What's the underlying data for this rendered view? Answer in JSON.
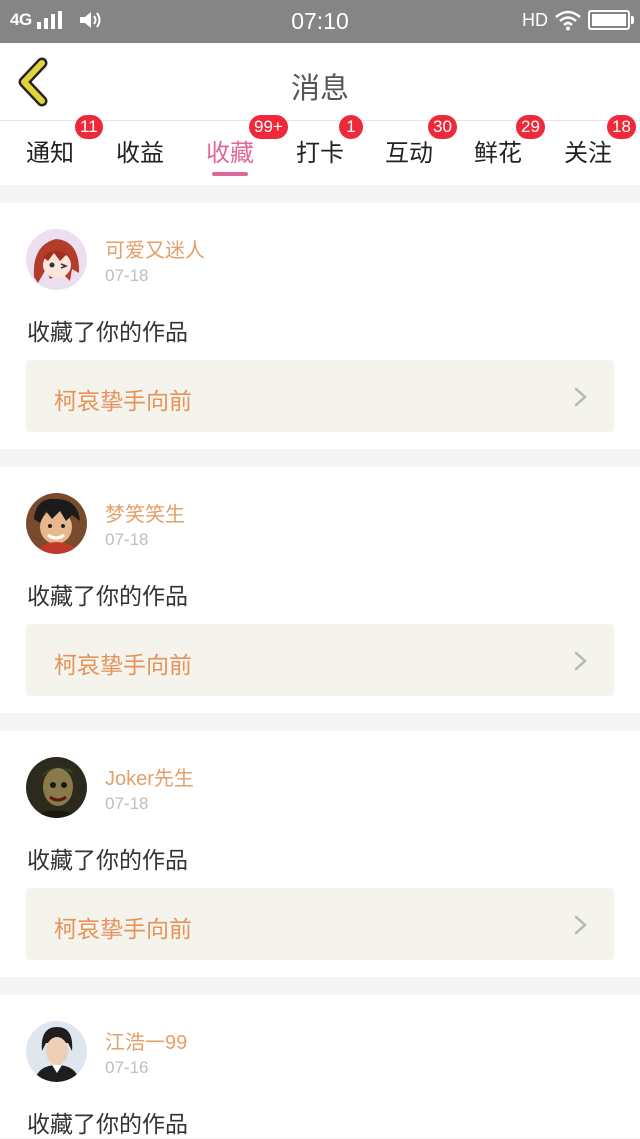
{
  "status_bar": {
    "network": "4G",
    "time": "07:10",
    "hd": "HD",
    "icons": [
      "signal-icon",
      "volume-icon",
      "wifi-icon",
      "battery-icon"
    ]
  },
  "header": {
    "title": "消息",
    "back_icon": "back-chevron-icon",
    "accent_color": "#e3d23a"
  },
  "tabs": [
    {
      "label": "通知",
      "badge": "11"
    },
    {
      "label": "收益",
      "badge": ""
    },
    {
      "label": "收藏",
      "badge": "99+",
      "active": true
    },
    {
      "label": "打卡",
      "badge": "1"
    },
    {
      "label": "互动",
      "badge": "30"
    },
    {
      "label": "鲜花",
      "badge": "29"
    },
    {
      "label": "关注",
      "badge": "18"
    }
  ],
  "feed": [
    {
      "user": "可爱又迷人",
      "date": "07-18",
      "action": "收藏了你的作品",
      "work": "柯哀挚手向前"
    },
    {
      "user": "梦笑笑生",
      "date": "07-18",
      "action": "收藏了你的作品",
      "work": "柯哀挚手向前"
    },
    {
      "user": "Joker先生",
      "date": "07-18",
      "action": "收藏了你的作品",
      "work": "柯哀挚手向前"
    },
    {
      "user": "江浩一99",
      "date": "07-16",
      "action": "收藏了你的作品",
      "work": ""
    }
  ],
  "colors": {
    "active_tab": "#e0679a",
    "badge": "#ee2a3a",
    "username": "#e2a06b",
    "work_title": "#e6935b",
    "work_bg": "#f4f3ec"
  }
}
